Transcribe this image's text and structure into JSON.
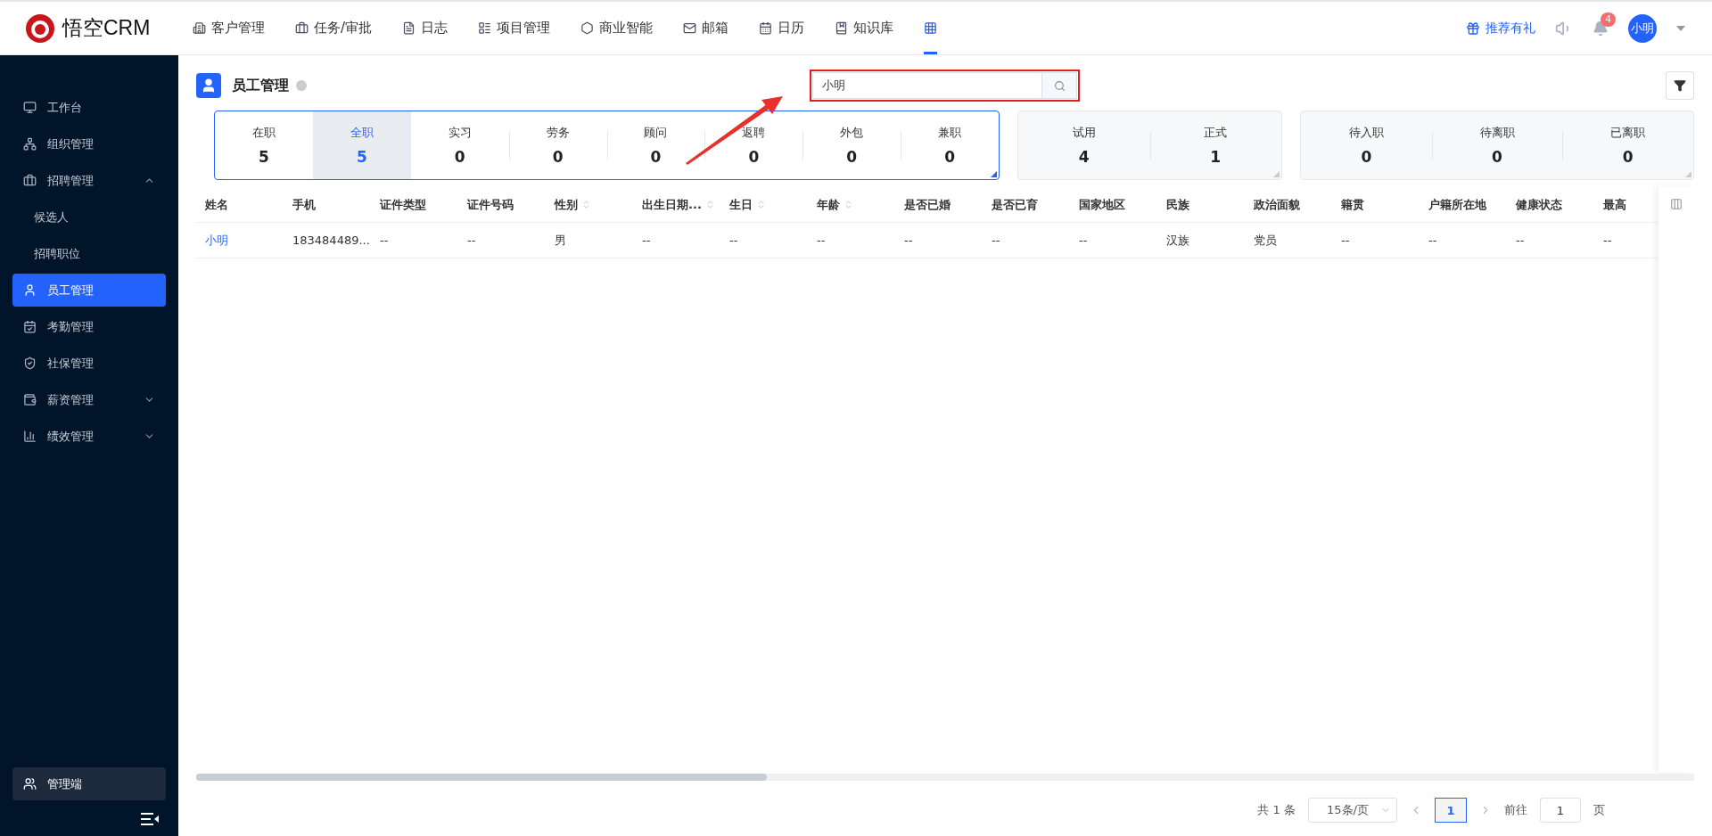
{
  "brand": {
    "name": "悟空CRM"
  },
  "nav": {
    "items": [
      {
        "label": "客户管理",
        "selected": false
      },
      {
        "label": "任务/审批",
        "selected": false
      },
      {
        "label": "日志",
        "selected": false
      },
      {
        "label": "项目管理",
        "selected": false
      },
      {
        "label": "商业智能",
        "selected": false
      },
      {
        "label": "邮箱",
        "selected": false
      },
      {
        "label": "日历",
        "selected": false
      },
      {
        "label": "知识库",
        "selected": false
      }
    ],
    "apps_selected": true
  },
  "topbar_right": {
    "promo": "推荐有礼",
    "notification_count": "4",
    "user": "小明"
  },
  "sidebar": {
    "items": [
      {
        "label": "工作台",
        "selected": false
      },
      {
        "label": "组织管理",
        "selected": false
      },
      {
        "label": "招聘管理",
        "selected": false,
        "expanded": true,
        "children": [
          {
            "label": "候选人",
            "selected": false
          },
          {
            "label": "招聘职位",
            "selected": false
          }
        ]
      },
      {
        "label": "员工管理",
        "selected": true
      },
      {
        "label": "考勤管理",
        "selected": false
      },
      {
        "label": "社保管理",
        "selected": false
      },
      {
        "label": "薪资管理",
        "selected": false,
        "expanded": false
      },
      {
        "label": "绩效管理",
        "selected": false,
        "expanded": false
      }
    ],
    "footer": "管理端"
  },
  "page": {
    "title": "员工管理",
    "search": {
      "value": "小明"
    }
  },
  "stats": [
    {
      "selected": true,
      "items": [
        {
          "label": "在职",
          "value": "5",
          "selected": false
        },
        {
          "label": "全职",
          "value": "5",
          "selected": true
        },
        {
          "label": "实习",
          "value": "0",
          "selected": false
        },
        {
          "label": "劳务",
          "value": "0",
          "selected": false
        },
        {
          "label": "顾问",
          "value": "0",
          "selected": false
        },
        {
          "label": "返聘",
          "value": "0",
          "selected": false
        },
        {
          "label": "外包",
          "value": "0",
          "selected": false
        },
        {
          "label": "兼职",
          "value": "0",
          "selected": false
        }
      ]
    },
    {
      "selected": false,
      "items": [
        {
          "label": "试用",
          "value": "4",
          "selected": false
        },
        {
          "label": "正式",
          "value": "1",
          "selected": false
        }
      ]
    },
    {
      "selected": false,
      "items": [
        {
          "label": "待入职",
          "value": "0",
          "selected": false
        },
        {
          "label": "待离职",
          "value": "0",
          "selected": false
        },
        {
          "label": "已离职",
          "value": "0",
          "selected": false
        }
      ]
    }
  ],
  "table": {
    "columns": [
      {
        "label": "姓名",
        "sortable": false
      },
      {
        "label": "手机",
        "sortable": false
      },
      {
        "label": "证件类型",
        "sortable": false
      },
      {
        "label": "证件号码",
        "sortable": false
      },
      {
        "label": "性别",
        "sortable": true
      },
      {
        "label": "出生日期...",
        "sortable": true
      },
      {
        "label": "生日",
        "sortable": true
      },
      {
        "label": "年龄",
        "sortable": true
      },
      {
        "label": "是否已婚",
        "sortable": false
      },
      {
        "label": "是否已育",
        "sortable": false
      },
      {
        "label": "国家地区",
        "sortable": false
      },
      {
        "label": "民族",
        "sortable": false
      },
      {
        "label": "政治面貌",
        "sortable": false
      },
      {
        "label": "籍贯",
        "sortable": false
      },
      {
        "label": "户籍所在地",
        "sortable": false
      },
      {
        "label": "健康状态",
        "sortable": false
      },
      {
        "label": "最高",
        "sortable": false
      }
    ],
    "rows": [
      [
        "小明",
        "183484489...",
        "--",
        "--",
        "男",
        "--",
        "--",
        "--",
        "--",
        "--",
        "--",
        "汉族",
        "党员",
        "--",
        "--",
        "--",
        "--"
      ]
    ]
  },
  "pagination": {
    "total": "共 1 条",
    "page_size": "15条/页",
    "pages": [
      {
        "label": "1",
        "selected": true
      }
    ],
    "goto_label": "前往",
    "goto_value": "1",
    "goto_suffix": "页"
  }
}
